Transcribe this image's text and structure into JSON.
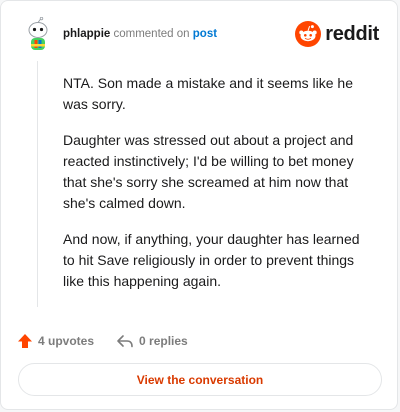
{
  "header": {
    "username": "phlappie",
    "action_text": "commented on",
    "post_link": "post",
    "brand_name": "reddit"
  },
  "comment": {
    "paragraphs": [
      "NTA. Son made a mistake and it seems like he was sorry.",
      "Daughter was stressed out about a project and reacted instinctively; I'd be willing to bet money that she's sorry she screamed at him now that she's calmed down.",
      "And now, if anything, your daughter has learned to hit Save religiously in order to prevent things like this happening again."
    ]
  },
  "actions": {
    "upvotes_label": "4 upvotes",
    "replies_label": "0 replies"
  },
  "cta": {
    "label": "View the conversation"
  },
  "colors": {
    "brand": "#ff4500",
    "link": "#0079d3",
    "cta_text": "#d93a00",
    "muted": "#7c7c7c"
  },
  "icons": {
    "avatar": "snoo-avatar-icon",
    "brand": "reddit-logo-icon",
    "upvote": "upvote-arrow-icon",
    "reply": "reply-arrow-icon"
  }
}
